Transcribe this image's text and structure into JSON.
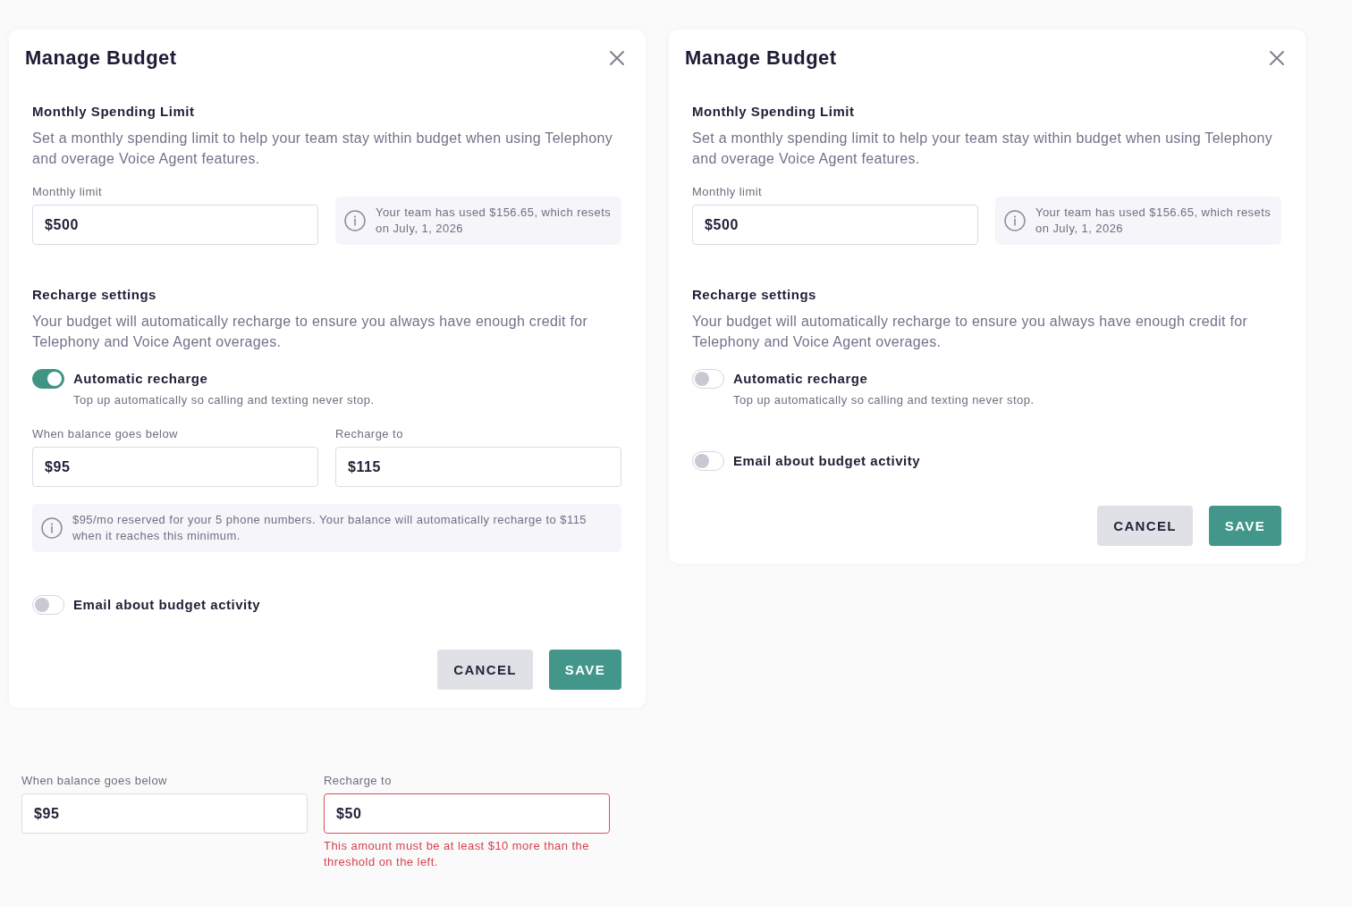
{
  "dialogs": [
    {
      "title": "Manage Budget",
      "spending_limit": {
        "heading": "Monthly Spending Limit",
        "description": "Set a monthly spending limit to help your team stay within budget when using Telephony and overage Voice Agent features.",
        "field": {
          "label": "Monthly limit",
          "value": "$500"
        },
        "note": "Your team has used $156.65, which resets on July, 1, 2026"
      },
      "recharge": {
        "heading": "Recharge settings",
        "description": "Your budget will automatically recharge to ensure you always have enough credit for Telephony and Voice Agent overages.",
        "toggle": {
          "label": "Automatic recharge",
          "hint": "Top up automatically so calling and texting never stop.",
          "on": true
        },
        "fields": [
          {
            "label": "When balance goes below",
            "value": "$95"
          },
          {
            "label": "Recharge to",
            "value": "$115"
          }
        ],
        "note": "$95/mo reserved for your 5 phone numbers. Your balance will automatically recharge to $115 when it reaches this minimum."
      },
      "email_toggle": {
        "label": "Email about budget activity",
        "on": false
      },
      "buttons": [
        {
          "label": "CANCEL",
          "kind": "secondary"
        },
        {
          "label": "SAVE",
          "kind": "primary"
        }
      ]
    },
    {
      "title": "Manage Budget",
      "spending_limit": {
        "heading": "Monthly Spending Limit",
        "description": "Set a monthly spending limit to help your team stay within budget when using Telephony and overage Voice Agent features.",
        "field": {
          "label": "Monthly limit",
          "value": "$500"
        },
        "note": "Your team has used $156.65, which resets on July, 1, 2026"
      },
      "recharge": {
        "heading": "Recharge settings",
        "description": "Your budget will automatically recharge to ensure you always have enough credit for Telephony and Voice Agent overages.",
        "toggle": {
          "label": "Automatic recharge",
          "hint": "Top up automatically so calling and texting never stop.",
          "on": false
        }
      },
      "email_toggle": {
        "label": "Email about budget activity",
        "on": false
      },
      "buttons": [
        {
          "label": "CANCEL",
          "kind": "secondary"
        },
        {
          "label": "SAVE",
          "kind": "primary"
        }
      ]
    }
  ],
  "validation_example": {
    "fields": [
      {
        "label": "When balance goes below",
        "value": "$95",
        "invalid": false
      },
      {
        "label": "Recharge to",
        "value": "$50",
        "invalid": true,
        "error": "This amount must be at least $10 more than the threshold on the left."
      }
    ]
  }
}
